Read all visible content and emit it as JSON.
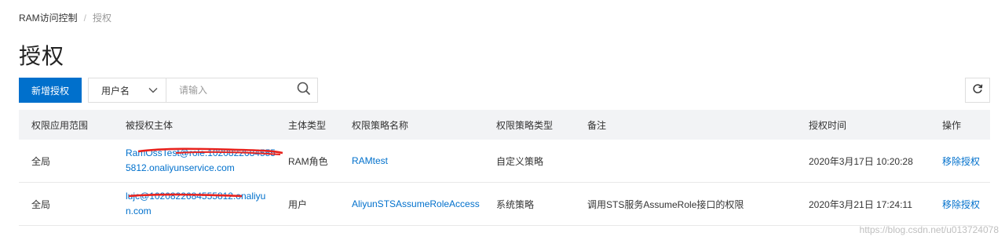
{
  "breadcrumb": {
    "root": "RAM访问控制",
    "separator": "/",
    "current": "授权"
  },
  "page_title": "授权",
  "toolbar": {
    "add_label": "新增授权",
    "filter_select_value": "用户名",
    "search_placeholder": "请输入"
  },
  "icons": {
    "chevron": "chevron-down-icon",
    "search": "search-icon",
    "refresh": "refresh-icon"
  },
  "colors": {
    "primary": "#0070cc",
    "header_bg": "#f2f3f5",
    "redaction": "#e8231e"
  },
  "table": {
    "columns": [
      "权限应用范围",
      "被授权主体",
      "主体类型",
      "权限策略名称",
      "权限策略类型",
      "备注",
      "授权时间",
      "操作"
    ],
    "rows": [
      {
        "scope": "全局",
        "principal_line1": "RamOssTest@role.1020822684555",
        "principal_line2": "5812.onaliyunservice.com",
        "principal_type": "RAM角色",
        "policy_name": "RAMtest",
        "policy_type": "自定义策略",
        "remark": "",
        "time": "2020年3月17日 10:20:28",
        "action": "移除授权"
      },
      {
        "scope": "全局",
        "principal_line1": "lujc@1020822684555812.onaliyu",
        "principal_line2": "n.com",
        "principal_type": "用户",
        "policy_name": "AliyunSTSAssumeRoleAccess",
        "policy_type": "系统策略",
        "remark": "调用STS服务AssumeRole接口的权限",
        "time": "2020年3月21日 17:24:11",
        "action": "移除授权"
      }
    ]
  },
  "watermark": "https://blog.csdn.net/u013724078"
}
